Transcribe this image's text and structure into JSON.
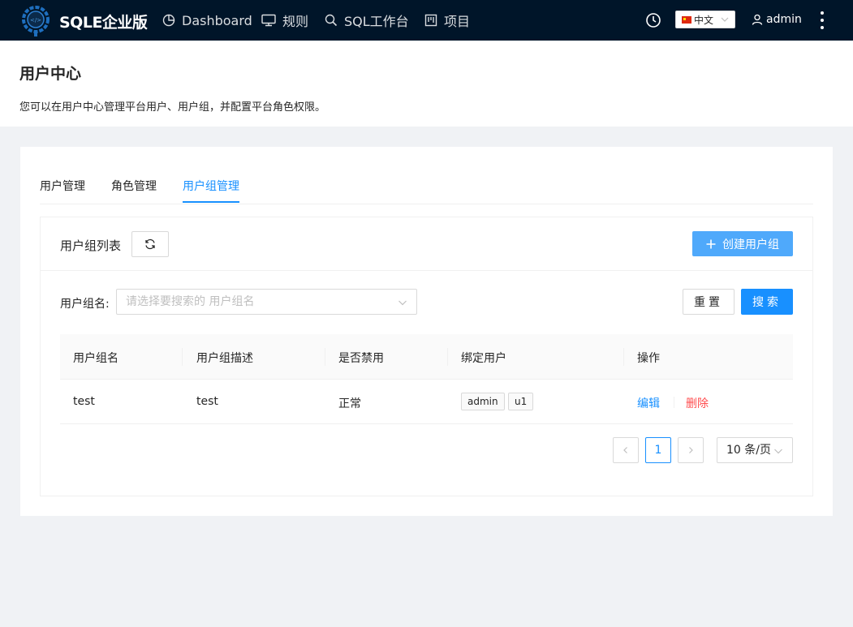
{
  "header": {
    "brand": "SQLE企业版",
    "nav": [
      {
        "label": "Dashboard",
        "icon": "pie-chart-icon"
      },
      {
        "label": "规则",
        "icon": "monitor-icon"
      },
      {
        "label": "SQL工作台",
        "icon": "search-icon"
      },
      {
        "label": "项目",
        "icon": "project-icon"
      }
    ],
    "language": "中文",
    "user": "admin",
    "icons": [
      "logo-icon",
      "clock-icon",
      "flag-cn-icon",
      "chevron-down-icon",
      "user-icon",
      "more-vertical-icon"
    ]
  },
  "page": {
    "title": "用户中心",
    "description": "您可以在用户中心管理平台用户、用户组，并配置平台角色权限。"
  },
  "tabs": [
    {
      "label": "用户管理",
      "active": false
    },
    {
      "label": "角色管理",
      "active": false
    },
    {
      "label": "用户组管理",
      "active": true
    }
  ],
  "list": {
    "title": "用户组列表",
    "create_label": "创建用户组"
  },
  "filter": {
    "label": "用户组名",
    "placeholder": "请选择要搜索的 用户组名",
    "reset_label": "重置",
    "search_label": "搜索"
  },
  "table": {
    "columns": [
      "用户组名",
      "用户组描述",
      "是否禁用",
      "绑定用户",
      "操作"
    ],
    "rows": [
      {
        "name": "test",
        "description": "test",
        "status": "正常",
        "users": [
          "admin",
          "u1"
        ],
        "edit_label": "编辑",
        "delete_label": "删除"
      }
    ]
  },
  "pagination": {
    "current": "1",
    "page_size": "10 条/页"
  },
  "colors": {
    "header_bg": "#001529",
    "primary": "#1890ff",
    "create_button": "#4fa9fb",
    "danger": "#ff4d4f"
  }
}
